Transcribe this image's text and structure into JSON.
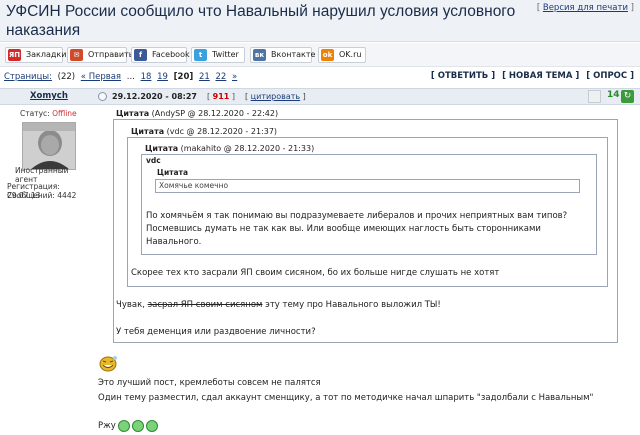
{
  "topic": {
    "title": "УФСИН России сообщило что Навальный нарушил условия условного наказания",
    "print_link": "Версия для печати"
  },
  "share_buttons": [
    {
      "icon": "yap-icon",
      "label": "Закладки",
      "color": "#d12a2a"
    },
    {
      "icon": "send-icon",
      "label": "Отправить",
      "color": "#d14a2a"
    },
    {
      "icon": "facebook-icon",
      "label": "Facebook",
      "color": "#3b5998"
    },
    {
      "icon": "twitter-icon",
      "label": "Twitter",
      "color": "#3aa1e0"
    },
    {
      "icon": "vk-icon",
      "label": "Вконтакте",
      "color": "#4c75a3"
    },
    {
      "icon": "ok-icon",
      "label": "OK.ru",
      "color": "#ee8208"
    }
  ],
  "pager": {
    "label": "Страницы:",
    "count": "(22)",
    "first": "« Первая",
    "ellipsis": "...",
    "pages": [
      "18",
      "19",
      "[20]",
      "21",
      "22"
    ],
    "last": "»"
  },
  "actions": [
    "[ ОТВЕТИТЬ ]",
    "[ НОВАЯ ТЕМА ]",
    "[ ОПРОС ]"
  ],
  "post": {
    "author": "Xomych",
    "date": "29.12.2020 - 08:27",
    "number": "911",
    "cite": "цитировать",
    "rating": "14",
    "status_label": "Статус:",
    "status_value": "Offline",
    "role": "Иностранный агент",
    "registration": "Регистрация: 29.07.13",
    "messages": "Сообщений: 4442"
  },
  "quotes": {
    "q1_title": "Цитата",
    "q1_meta": "(AndySP @ 28.12.2020 - 22:42)",
    "q2_title": "Цитата",
    "q2_meta": "(vdc @ 28.12.2020 - 21:37)",
    "q3_title": "Цитата",
    "q3_meta": "(makahito @ 28.12.2020 - 21:33)",
    "vdc_label": "vdc",
    "q4_title": "Цитата",
    "q4_text": "Хомячье комечно",
    "q3_reply_line1": "По хомячьём я так понимаю вы подразумеваете либералов и прочих неприятных вам типов?",
    "q3_reply_line2": "Посмевшись думать не так как вы. Или вообще имеющих наглость быть сторонниками",
    "q3_reply_line3": "Навального.",
    "q2_reply": "Скорее тех кто засрали ЯП своим сисяном, бо их больше нигде слушать не хотят",
    "q1_reply_prefix": "Чувак,",
    "q1_reply_strike": "засрал ЯП своим сисяном",
    "q1_reply_suffix": "эту тему про Навального выложил ТЫ!",
    "q1_reply_line2": "У тебя деменция или раздвоение личности?"
  },
  "body": {
    "line1": "Это лучший пост, кремлеботы совсем не палятся",
    "line2": "Один тему разместил, сдал аккаунт сменщику, а тот по методичке начал шпарить \"задолбали с Навальным\"",
    "line3": "Ржу"
  }
}
